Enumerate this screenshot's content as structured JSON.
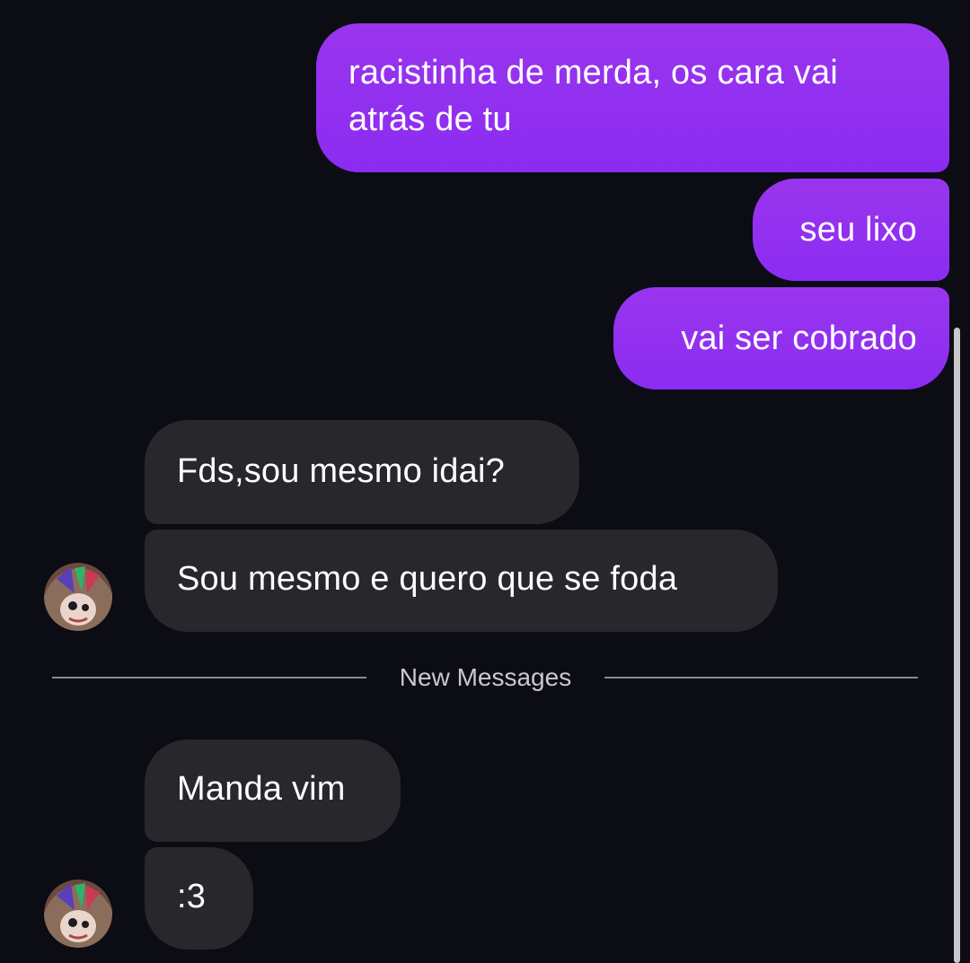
{
  "messages": {
    "outgoing": [
      {
        "text": "racistinha de merda, os cara vai atrás de tu"
      },
      {
        "text": "seu lixo"
      },
      {
        "text": "vai ser cobrado"
      }
    ],
    "incoming_before": [
      {
        "text": "Fds,sou mesmo idai?"
      },
      {
        "text": "Sou mesmo e quero que se foda"
      }
    ],
    "divider_label": "New Messages",
    "incoming_after": [
      {
        "text": "Manda vim"
      },
      {
        "text": ":3"
      }
    ]
  },
  "colors": {
    "background": "#0b0c14",
    "outgoing_bubble": "#8b2cf2",
    "incoming_bubble": "#27272c",
    "divider": "#8a8a90"
  },
  "icons": {
    "avatar": "contact-avatar-icon"
  }
}
